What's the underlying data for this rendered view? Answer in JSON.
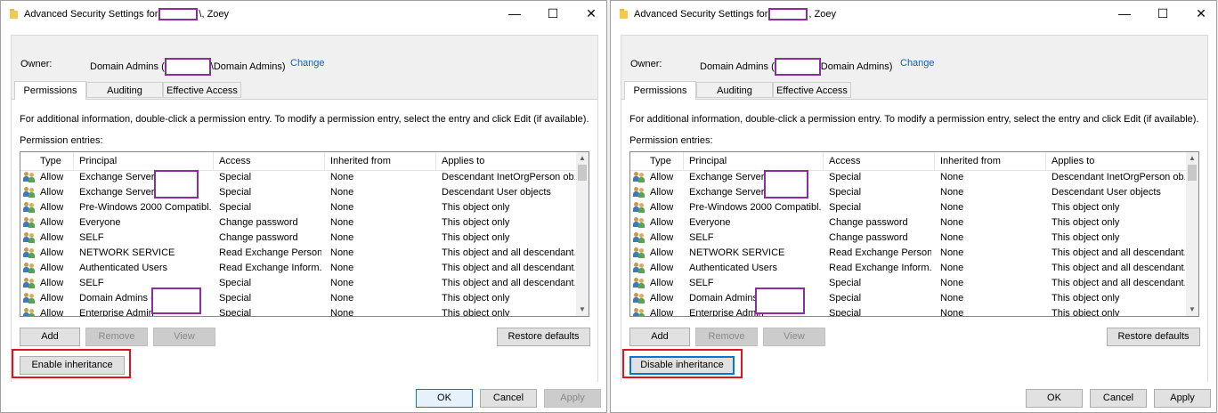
{
  "windows": [
    {
      "id": "winL",
      "title_prefix": "Advanced Security Settings for",
      "title_suffix": "\\, Zoey",
      "controls": {
        "minimize": "—",
        "maximize": "☐",
        "close": "✕"
      },
      "owner_label": "Owner:",
      "owner_prefix": "Domain Admins (",
      "owner_suffix": "\\Domain Admins)",
      "change_label": "Change",
      "tabs": [
        "Permissions",
        "Auditing",
        "Effective Access"
      ],
      "info_text": "For additional information, double-click a permission entry. To modify a permission entry, select the entry and click Edit (if available).",
      "entries_label": "Permission entries:",
      "columns": [
        "Type",
        "Principal",
        "Access",
        "Inherited from",
        "Applies to"
      ],
      "rows": [
        [
          "Allow",
          "Exchange Servers (",
          "Special",
          "None",
          "Descendant InetOrgPerson ob..."
        ],
        [
          "Allow",
          "Exchange Servers (",
          "Special",
          "None",
          "Descendant User objects"
        ],
        [
          "Allow",
          "Pre-Windows 2000 Compatibl...",
          "Special",
          "None",
          "This object only"
        ],
        [
          "Allow",
          "Everyone",
          "Change password",
          "None",
          "This object only"
        ],
        [
          "Allow",
          "SELF",
          "Change password",
          "None",
          "This object only"
        ],
        [
          "Allow",
          "NETWORK SERVICE",
          "Read Exchange Person...",
          "None",
          "This object and all descendant..."
        ],
        [
          "Allow",
          "Authenticated Users",
          "Read Exchange Inform...",
          "None",
          "This object and all descendant..."
        ],
        [
          "Allow",
          "SELF",
          "Special",
          "None",
          "This object and all descendant..."
        ],
        [
          "Allow",
          "Domain Admins (",
          "Special",
          "None",
          "This object only"
        ],
        [
          "Allow",
          "Enterprise Admin",
          "Special",
          "None",
          "This object only"
        ]
      ],
      "buttons": {
        "add": "Add",
        "remove": "Remove",
        "view": "View",
        "restore": "Restore defaults",
        "inheritance": "Enable inheritance",
        "ok": "OK",
        "cancel": "Cancel",
        "apply": "Apply"
      },
      "apply_enabled": false,
      "inheritance_focused": false
    },
    {
      "id": "winR",
      "title_prefix": "Advanced Security Settings for",
      "title_suffix": ", Zoey",
      "controls": {
        "minimize": "—",
        "maximize": "☐",
        "close": "✕"
      },
      "owner_label": "Owner:",
      "owner_prefix": "Domain Admins (",
      "owner_suffix": "Domain Admins)",
      "change_label": "Change",
      "tabs": [
        "Permissions",
        "Auditing",
        "Effective Access"
      ],
      "info_text": "For additional information, double-click a permission entry. To modify a permission entry, select the entry and click Edit (if available).",
      "entries_label": "Permission entries:",
      "columns": [
        "Type",
        "Principal",
        "Access",
        "Inherited from",
        "Applies to"
      ],
      "rows": [
        [
          "Allow",
          "Exchange Servers (",
          "Special",
          "None",
          "Descendant InetOrgPerson ob..."
        ],
        [
          "Allow",
          "Exchange Servers (",
          "Special",
          "None",
          "Descendant User objects"
        ],
        [
          "Allow",
          "Pre-Windows 2000 Compatibl...",
          "Special",
          "None",
          "This object only"
        ],
        [
          "Allow",
          "Everyone",
          "Change password",
          "None",
          "This object only"
        ],
        [
          "Allow",
          "SELF",
          "Change password",
          "None",
          "This object only"
        ],
        [
          "Allow",
          "NETWORK SERVICE",
          "Read Exchange Person...",
          "None",
          "This object and all descendant..."
        ],
        [
          "Allow",
          "Authenticated Users",
          "Read Exchange Inform...",
          "None",
          "This object and all descendant..."
        ],
        [
          "Allow",
          "SELF",
          "Special",
          "None",
          "This object and all descendant..."
        ],
        [
          "Allow",
          "Domain Admins",
          "Special",
          "None",
          "This object only"
        ],
        [
          "Allow",
          "Enterprise Admin",
          "Special",
          "None",
          "This object only"
        ]
      ],
      "buttons": {
        "add": "Add",
        "remove": "Remove",
        "view": "View",
        "restore": "Restore defaults",
        "inheritance": "Disable inheritance",
        "ok": "OK",
        "cancel": "Cancel",
        "apply": "Apply"
      },
      "apply_enabled": true,
      "inheritance_focused": true
    }
  ],
  "colors": {
    "highlight": "#e0141e",
    "redaction": "#8a2e9b",
    "link": "#1a5fb4",
    "accent": "#0078d7"
  }
}
